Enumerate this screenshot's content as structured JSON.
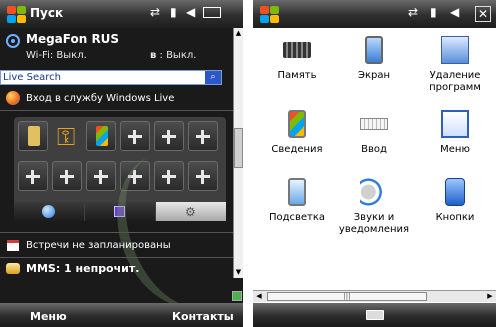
{
  "left": {
    "title": "Пуск",
    "tray_icons": [
      "sync-icon",
      "signal-icon",
      "volume-icon",
      "battery-icon"
    ],
    "operator": {
      "name": "MegaFon RUS",
      "wifi": "Wi-Fi: Выкл.",
      "bluetooth": ": Выкл."
    },
    "search": {
      "label": "Live Search"
    },
    "live_login": "Вход в службу Windows Live",
    "appointments": "Встречи не запланированы",
    "mms": "MMS: 1 непрочит.",
    "softkeys": {
      "left": "Меню",
      "right": "Контакты"
    }
  },
  "right": {
    "tray_icons": [
      "sync-icon",
      "signal-icon",
      "volume-icon"
    ],
    "items": [
      {
        "label": "Память",
        "icon": "memory-icon"
      },
      {
        "label": "Экран",
        "icon": "screen-icon"
      },
      {
        "label": "Удаление программ",
        "icon": "remove-programs-icon"
      },
      {
        "label": "Сведения",
        "icon": "about-icon"
      },
      {
        "label": "Ввод",
        "icon": "input-icon"
      },
      {
        "label": "Меню",
        "icon": "menu-icon"
      },
      {
        "label": "Подсветка",
        "icon": "backlight-icon"
      },
      {
        "label": "Звуки и уведомления",
        "icon": "sounds-icon"
      },
      {
        "label": "Кнопки",
        "icon": "buttons-icon"
      }
    ]
  },
  "colors": {
    "titlebar": "#2f2f2f",
    "accent_blue": "#2c57c8",
    "selected_tab": "#cfcfcf"
  }
}
